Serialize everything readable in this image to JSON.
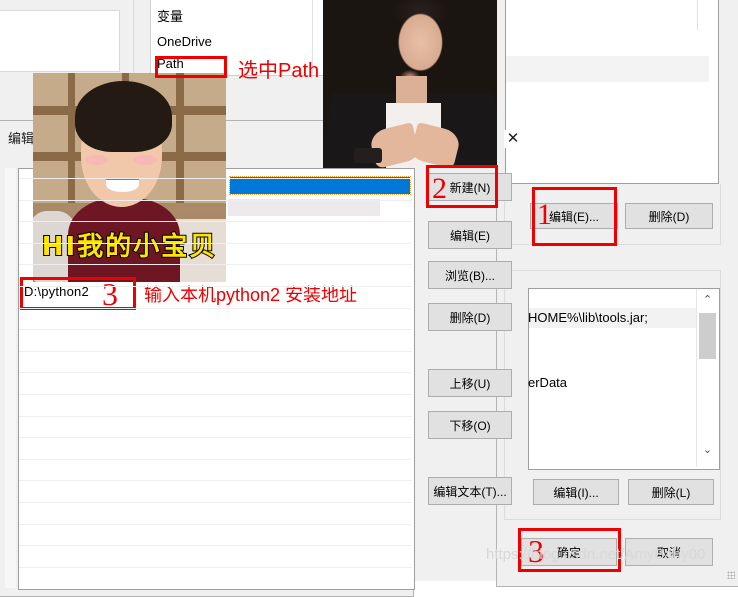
{
  "background": {
    "window_bg_color": "#f0f0f0"
  },
  "env_list": {
    "header": "变量",
    "rows": [
      {
        "label": "OneDrive",
        "selected": false
      },
      {
        "label": "Path",
        "selected": true
      }
    ]
  },
  "left_dialog": {
    "title": "编辑",
    "value_text": "D:\\python2",
    "selected_row_value": "",
    "middle_buttons": [
      {
        "id": "new",
        "label": "新建(N)",
        "accesskey": "N"
      },
      {
        "id": "edit",
        "label": "编辑(E)",
        "accesskey": "E"
      },
      {
        "id": "browse",
        "label": "浏览(B)...",
        "accesskey": "B"
      },
      {
        "id": "delete",
        "label": "删除(D)",
        "accesskey": "D"
      },
      {
        "id": "move_up",
        "label": "上移(U)",
        "accesskey": "U"
      },
      {
        "id": "move_down",
        "label": "下移(O)",
        "accesskey": "O"
      },
      {
        "id": "edit_text",
        "label": "编辑文本(T)...",
        "accesskey": "T"
      }
    ]
  },
  "main_dialog": {
    "upper_buttons": [
      {
        "id": "edit_e",
        "label": "编辑(E)...",
        "accesskey": "E"
      },
      {
        "id": "delete_d",
        "label": "删除(D)",
        "accesskey": "D"
      }
    ],
    "list_lines": [
      "HOME%\\lib\\tools.jar;",
      "erData"
    ],
    "lower_buttons": [
      {
        "id": "edit_i",
        "label": "编辑(I)...",
        "accesskey": "I"
      },
      {
        "id": "delete_l",
        "label": "删除(L)",
        "accesskey": "L"
      }
    ],
    "footer_buttons": [
      {
        "id": "ok",
        "label": "确定"
      },
      {
        "id": "cancel",
        "label": "取消"
      }
    ],
    "scrollbar": {
      "up_arrow": "⌃",
      "down_arrow": "⌄"
    }
  },
  "annotations": {
    "accent_color": "#ee0000",
    "steps": [
      {
        "number": "1",
        "target": "编辑(E)..."
      },
      {
        "number": "2",
        "target": "新建(N)"
      },
      {
        "number": "3",
        "target": "D:\\python2"
      },
      {
        "number": "3",
        "target": "确定"
      }
    ],
    "captions": [
      {
        "id": "select_path",
        "text": "选中Path"
      },
      {
        "id": "enter_python",
        "text": "输入本机python2 安装地址"
      }
    ]
  },
  "photos": {
    "top": {
      "caption": ""
    },
    "left": {
      "caption": "HI我的小宝贝"
    }
  },
  "overlay": {
    "close_icon": "✕"
  },
  "watermark": "https://blog.csdn.net/AmyBaby00"
}
